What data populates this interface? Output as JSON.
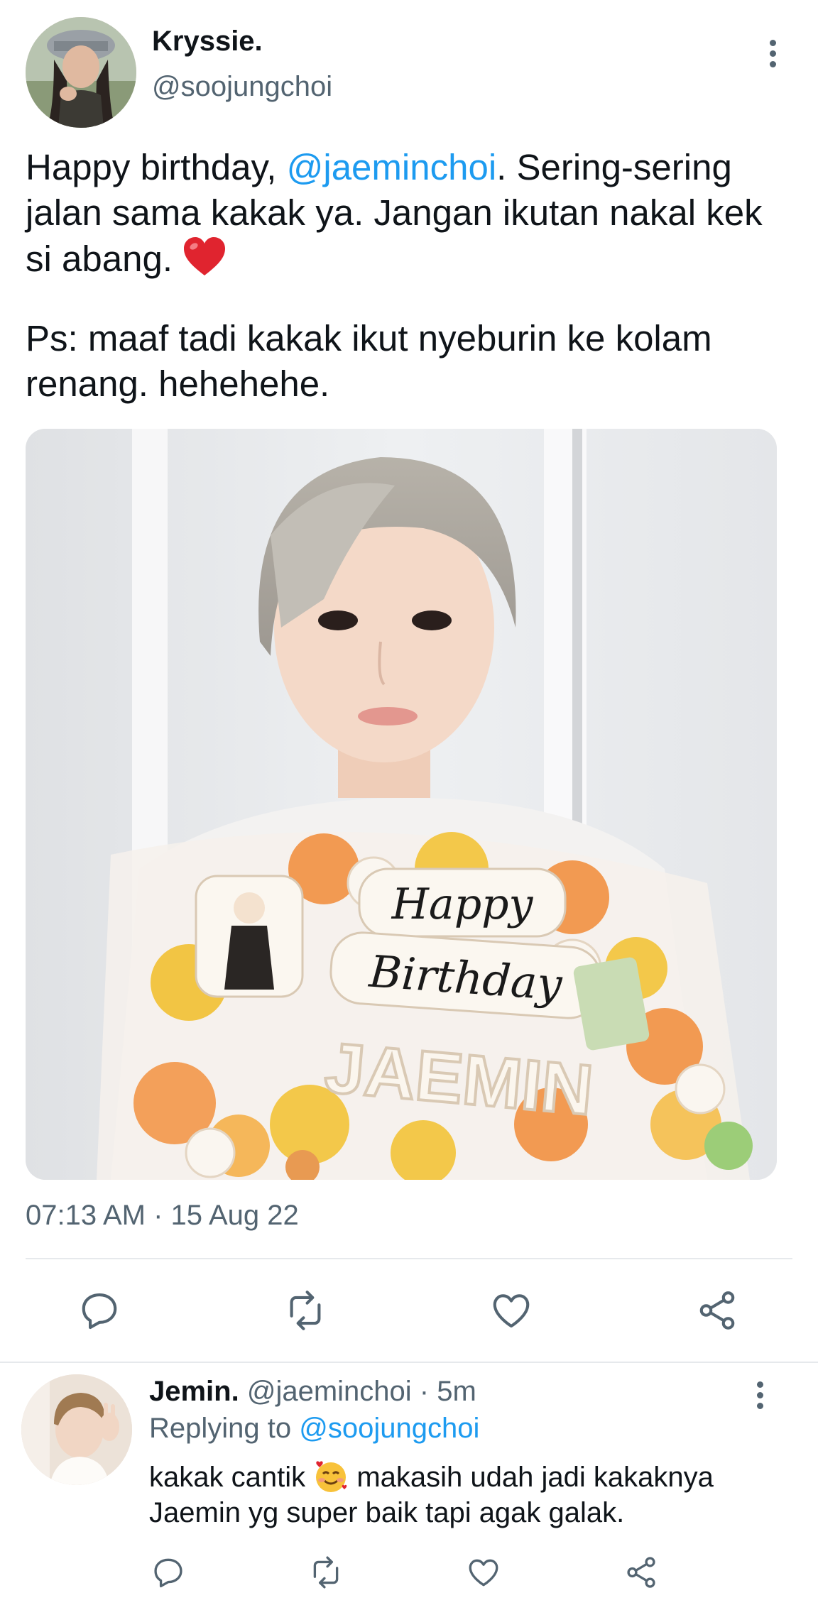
{
  "tweet": {
    "display_name": "Kryssie.",
    "handle": "@soojungchoi",
    "text_before_mention": "Happy birthday, ",
    "mention": "@jaeminchoi",
    "text_after_mention": ". Sering-sering jalan sama kakak ya. Jangan ikutan nakal kek si abang. ",
    "emoji": "red-heart",
    "text_second_paragraph": "Ps: maaf tadi kakak ikut nyeburin ke kolam renang. hehehehe.",
    "photo_cookie_lines": [
      "Happy",
      "Birthday",
      "JAEMIN"
    ],
    "timestamp": "07:13 AM · 15 Aug 22",
    "actions": [
      "reply-icon",
      "retweet-icon",
      "like-icon",
      "share-icon"
    ]
  },
  "reply": {
    "display_name": "Jemin.",
    "meta": " @jaeminchoi · 5m",
    "replying_prefix": "Replying to ",
    "replying_to": "@soojungchoi",
    "text_before_emoji": "kakak cantik ",
    "emoji": "smiling-face-with-hearts",
    "text_after_emoji": " makasih udah jadi kakaknya Jaemin yg super baik tapi agak galak.",
    "actions": [
      "reply-icon",
      "retweet-icon",
      "like-icon",
      "share-icon"
    ]
  },
  "colors": {
    "accent": "#1d9bf0",
    "secondary_text": "#536471",
    "primary_text": "#0f1419"
  }
}
